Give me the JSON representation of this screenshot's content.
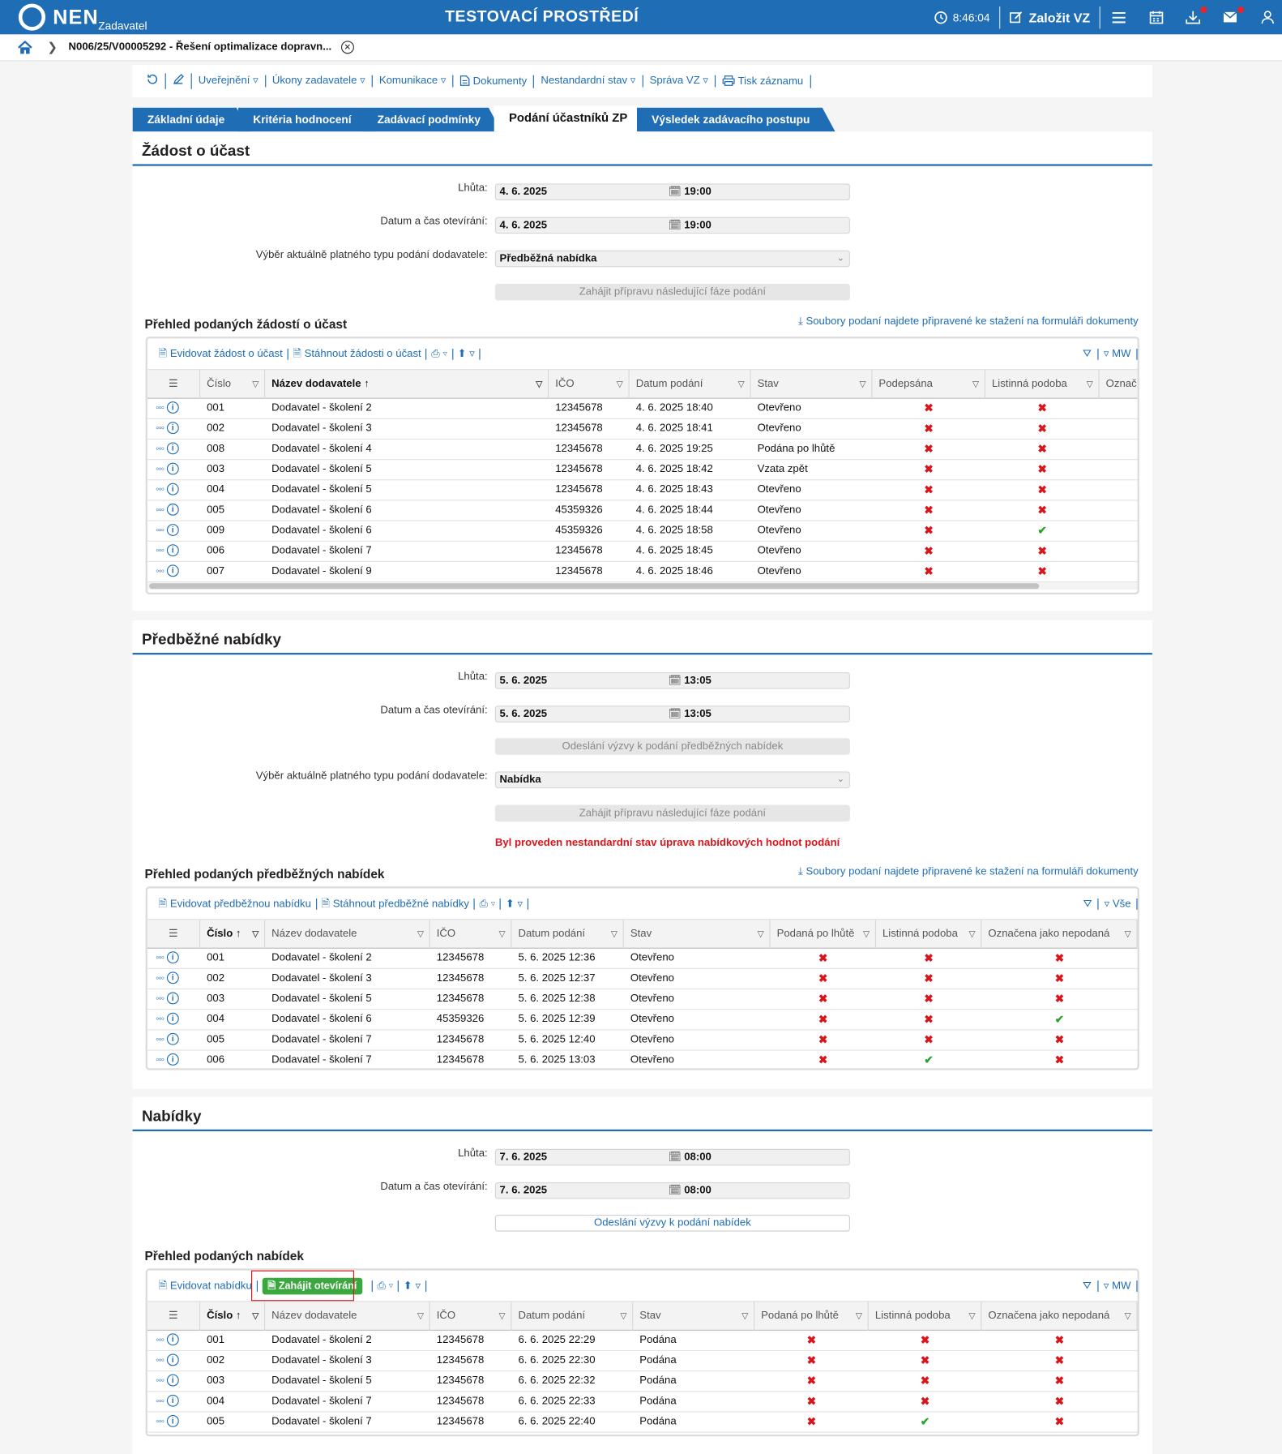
{
  "topbar": {
    "logo_text": "NEN",
    "logo_sub": "Zadavatel",
    "environment": "TESTOVACÍ PROSTŘEDÍ",
    "clock": "8:46:04",
    "create_label": "Založit VZ",
    "icons": [
      "menu-icon",
      "calendar-icon",
      "download-icon",
      "mail-icon",
      "user-icon"
    ]
  },
  "breadcrumb": {
    "text": "N006/25/V00005292 - Řešení optimalizace dopravn..."
  },
  "menu": {
    "items": [
      "Uveřejnění ▿",
      "Úkony zadavatele ▿",
      "Komunikace ▿",
      "Dokumenty",
      "Nestandardní stav ▿",
      "Správa VZ ▿",
      "Tisk záznamu"
    ]
  },
  "tabs": [
    "Základní údaje",
    "Kritéria hodnocení",
    "Zadávací podmínky",
    "Podání účastníků ZP",
    "Výsledek zadávacího postupu"
  ],
  "colors": {
    "primary": "#1f6db5",
    "error": "#d9141b",
    "success": "#2aa12f",
    "button_green": "#3aa83e"
  },
  "s1": {
    "title": "Žádost o účast",
    "deadline_label": "Lhůta:",
    "deadline_date": "4. 6. 2025",
    "deadline_time": "19:00",
    "open_label": "Datum a čas otevírání:",
    "open_date": "4. 6. 2025",
    "open_time": "19:00",
    "type_label": "Výběr aktuálně platného typu podání dodavatele:",
    "type_value": "Předběžná nabídka",
    "next_phase_btn": "Zahájit přípravu následující fáze podání",
    "grid_title": "Přehled podaných žádostí o účast",
    "files_link": "Soubory podaní najdete připravené ke stažení na formuláři dokumenty",
    "tool_add": "Evidovat žádost o účast",
    "tool_download": "Stáhnout žádosti o účast",
    "tool_right": "MW",
    "columns": [
      "Číslo",
      "Název dodavatele",
      "IČO",
      "Datum podání",
      "Stav",
      "Podepsána",
      "Listinná podoba",
      "Označ"
    ],
    "rows": [
      {
        "num": "001",
        "name": "Dodavatel - školení 2",
        "ico": "12345678",
        "date": "4. 6. 2025 18:40",
        "status": "Otevřeno",
        "signed": "x",
        "paper": "x"
      },
      {
        "num": "002",
        "name": "Dodavatel - školení 3",
        "ico": "12345678",
        "date": "4. 6. 2025 18:41",
        "status": "Otevřeno",
        "signed": "x",
        "paper": "x"
      },
      {
        "num": "008",
        "name": "Dodavatel - školení 4",
        "ico": "12345678",
        "date": "4. 6. 2025 19:25",
        "status": "Podána po lhůtě",
        "signed": "x",
        "paper": "x"
      },
      {
        "num": "003",
        "name": "Dodavatel - školení 5",
        "ico": "12345678",
        "date": "4. 6. 2025 18:42",
        "status": "Vzata zpět",
        "signed": "x",
        "paper": "x"
      },
      {
        "num": "004",
        "name": "Dodavatel - školení 5",
        "ico": "12345678",
        "date": "4. 6. 2025 18:43",
        "status": "Otevřeno",
        "signed": "x",
        "paper": "x"
      },
      {
        "num": "005",
        "name": "Dodavatel - školení 6",
        "ico": "45359326",
        "date": "4. 6. 2025 18:44",
        "status": "Otevřeno",
        "signed": "x",
        "paper": "x"
      },
      {
        "num": "009",
        "name": "Dodavatel - školení 6",
        "ico": "45359326",
        "date": "4. 6. 2025 18:58",
        "status": "Otevřeno",
        "signed": "x",
        "paper": "ok"
      },
      {
        "num": "006",
        "name": "Dodavatel - školení 7",
        "ico": "12345678",
        "date": "4. 6. 2025 18:45",
        "status": "Otevřeno",
        "signed": "x",
        "paper": "x"
      },
      {
        "num": "007",
        "name": "Dodavatel - školení 9",
        "ico": "12345678",
        "date": "4. 6. 2025 18:46",
        "status": "Otevřeno",
        "signed": "x",
        "paper": "x"
      }
    ]
  },
  "s2": {
    "title": "Předběžné nabídky",
    "deadline_label": "Lhůta:",
    "deadline_date": "5. 6. 2025",
    "deadline_time": "13:05",
    "open_label": "Datum a čas otevírání:",
    "open_date": "5. 6. 2025",
    "open_time": "13:05",
    "invite_btn": "Odeslání výzvy k podání předběžných nabídek",
    "type_label": "Výběr aktuálně platného typu podání dodavatele:",
    "type_value": "Nabídka",
    "next_phase_btn": "Zahájit přípravu následující fáze podání",
    "warning": "Byl proveden nestandardní stav úprava nabídkových hodnot podání",
    "grid_title": "Přehled podaných předběžných nabídek",
    "files_link": "Soubory podaní najdete připravené ke stažení na formuláři dokumenty",
    "tool_add": "Evidovat předběžnou nabídku",
    "tool_download": "Stáhnout předběžné nabídky",
    "tool_right": "Vše",
    "columns": [
      "Číslo",
      "Název dodavatele",
      "IČO",
      "Datum podání",
      "Stav",
      "Podaná po lhůtě",
      "Listinná podoba",
      "Označena jako nepodaná"
    ],
    "rows": [
      {
        "num": "001",
        "name": "Dodavatel - školení 2",
        "ico": "12345678",
        "date": "5. 6. 2025 12:36",
        "status": "Otevřeno",
        "late": "x",
        "paper": "x",
        "unsub": "x"
      },
      {
        "num": "002",
        "name": "Dodavatel - školení 3",
        "ico": "12345678",
        "date": "5. 6. 2025 12:37",
        "status": "Otevřeno",
        "late": "x",
        "paper": "x",
        "unsub": "x"
      },
      {
        "num": "003",
        "name": "Dodavatel - školení 5",
        "ico": "12345678",
        "date": "5. 6. 2025 12:38",
        "status": "Otevřeno",
        "late": "x",
        "paper": "x",
        "unsub": "x"
      },
      {
        "num": "004",
        "name": "Dodavatel - školení 6",
        "ico": "45359326",
        "date": "5. 6. 2025 12:39",
        "status": "Otevřeno",
        "late": "x",
        "paper": "x",
        "unsub": "ok"
      },
      {
        "num": "005",
        "name": "Dodavatel - školení 7",
        "ico": "12345678",
        "date": "5. 6. 2025 12:40",
        "status": "Otevřeno",
        "late": "x",
        "paper": "x",
        "unsub": "x"
      },
      {
        "num": "006",
        "name": "Dodavatel - školení 7",
        "ico": "12345678",
        "date": "5. 6. 2025 13:03",
        "status": "Otevřeno",
        "late": "x",
        "paper": "ok",
        "unsub": "x"
      }
    ]
  },
  "s3": {
    "title": "Nabídky",
    "deadline_label": "Lhůta:",
    "deadline_date": "7. 6. 2025",
    "deadline_time": "08:00",
    "open_label": "Datum a čas otevírání:",
    "open_date": "7. 6. 2025",
    "open_time": "08:00",
    "invite_btn": "Odeslání výzvy k podání nabídek",
    "grid_title": "Přehled podaných nabídek",
    "tool_add": "Evidovat nabídku",
    "tool_open": "Zahájit otevírání",
    "tool_right": "MW",
    "columns": [
      "Číslo",
      "Název dodavatele",
      "IČO",
      "Datum podání",
      "Stav",
      "Podaná po lhůtě",
      "Listinná podoba",
      "Označena jako nepodaná"
    ],
    "rows": [
      {
        "num": "001",
        "name": "Dodavatel - školení 2",
        "ico": "12345678",
        "date": "6. 6. 2025 22:29",
        "status": "Podána",
        "late": "x",
        "paper": "x",
        "unsub": "x"
      },
      {
        "num": "002",
        "name": "Dodavatel - školení 3",
        "ico": "12345678",
        "date": "6. 6. 2025 22:30",
        "status": "Podána",
        "late": "x",
        "paper": "x",
        "unsub": "x"
      },
      {
        "num": "003",
        "name": "Dodavatel - školení 5",
        "ico": "12345678",
        "date": "6. 6. 2025 22:32",
        "status": "Podána",
        "late": "x",
        "paper": "x",
        "unsub": "x"
      },
      {
        "num": "004",
        "name": "Dodavatel - školení 7",
        "ico": "12345678",
        "date": "6. 6. 2025 22:33",
        "status": "Podána",
        "late": "x",
        "paper": "x",
        "unsub": "x"
      },
      {
        "num": "005",
        "name": "Dodavatel - školení 7",
        "ico": "12345678",
        "date": "6. 6. 2025 22:40",
        "status": "Podána",
        "late": "x",
        "paper": "ok",
        "unsub": "x"
      }
    ]
  }
}
